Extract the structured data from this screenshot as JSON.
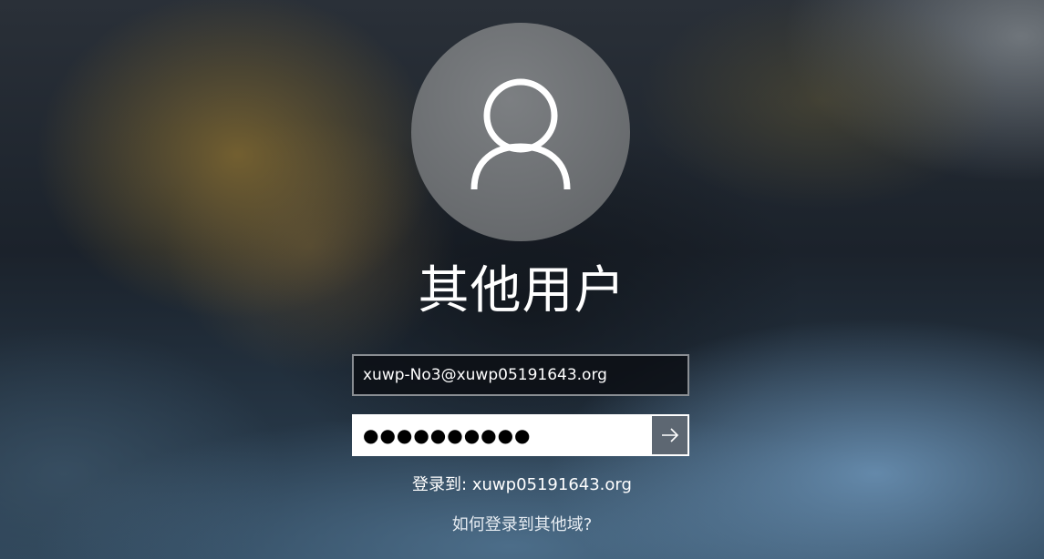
{
  "user": {
    "display_name": "其他用户"
  },
  "username_field": {
    "value": "xuwp-No3@xuwp05191643.org"
  },
  "password_field": {
    "masked_value": "●●●●●●●●●●"
  },
  "submit": {
    "icon": "arrow-right-icon"
  },
  "avatar": {
    "icon": "user-silhouette-icon"
  },
  "sign_in": {
    "label": "登录到:",
    "domain": "xuwp05191643.org"
  },
  "links": {
    "other_domain": "如何登录到其他域?"
  }
}
